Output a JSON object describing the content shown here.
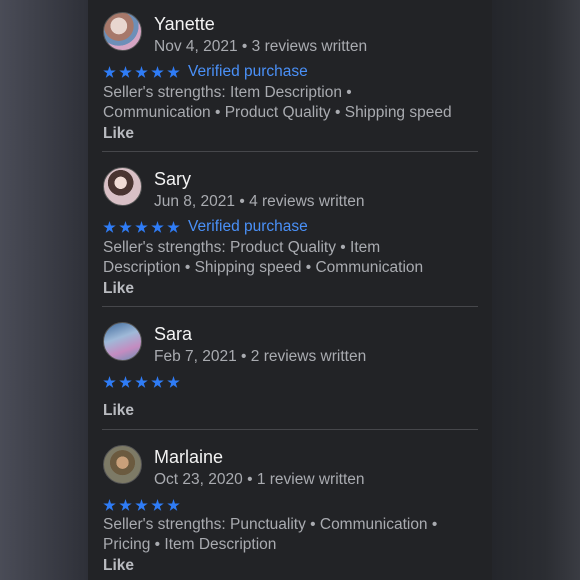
{
  "reviews": [
    {
      "name": "Yanette",
      "date": "Nov 4, 2021",
      "reviews_written": "3 reviews written",
      "rating": 5,
      "verified": "Verified purchase",
      "strengths": "Seller's strengths: Item Description • Communication • Product Quality • Shipping speed",
      "like": "Like",
      "avatar_colors": [
        "#c9a58f",
        "#7a5b54",
        "#d8c8c0"
      ]
    },
    {
      "name": "Sary",
      "date": "Jun 8, 2021",
      "reviews_written": "4 reviews written",
      "rating": 5,
      "verified": "Verified purchase",
      "strengths": "Seller's strengths: Product Quality • Item Description • Shipping speed • Communication",
      "like": "Like",
      "avatar_colors": [
        "#e7d8dc",
        "#5b3f3a",
        "#c79aa0"
      ]
    },
    {
      "name": "Sara",
      "date": "Feb 7, 2021",
      "reviews_written": "2 reviews written",
      "rating": 5,
      "verified": "",
      "strengths": "",
      "like": "Like",
      "avatar_colors": [
        "#b3c6dc",
        "#3d5f86",
        "#d5a0c2"
      ]
    },
    {
      "name": "Marlaine",
      "date": "Oct 23, 2020",
      "reviews_written": "1 review written",
      "rating": 5,
      "verified": "",
      "strengths": "Seller's strengths: Punctuality • Communication • Pricing • Item Description",
      "like": "Like",
      "avatar_colors": [
        "#6f6a56",
        "#b98a5e",
        "#4e4a3c"
      ]
    }
  ],
  "colors": {
    "star": "#2f7cf6",
    "verified": "#4a90f7",
    "panel_bg": "#222326"
  },
  "icons": {
    "star": "star-icon"
  }
}
